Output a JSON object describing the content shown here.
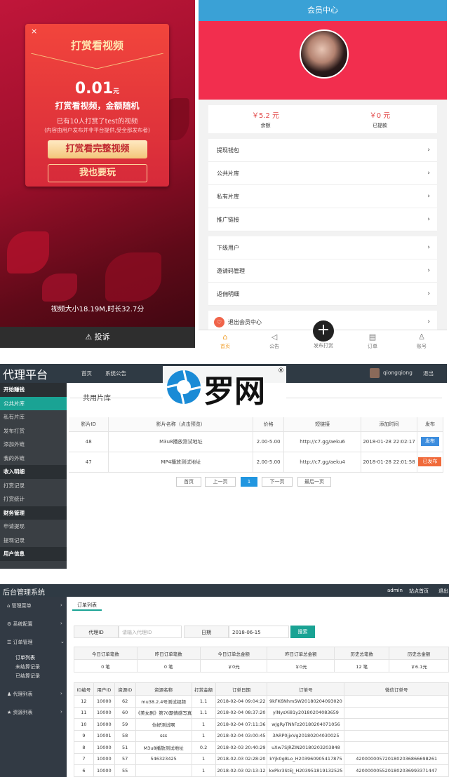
{
  "mobile_left": {
    "close": "×",
    "title": "打赏看视频",
    "amount": "0.01",
    "amount_unit": "元",
    "subtitle": "打赏看视频，金额随机",
    "info": "已有10人打赏了test的视频",
    "note": "(内容由用户发布并非平台提供,受全部发布者)",
    "primary_button": "打赏看完整视频",
    "secondary_button": "我也要玩",
    "video_info": "视频大小18.19M,时长32.7分",
    "complain": "⚠ 投诉"
  },
  "mobile_right": {
    "header": "会员中心",
    "balance_value": "￥5.2 元",
    "balance_label": "余额",
    "withdrawn_value": "￥0 元",
    "withdrawn_label": "已提款",
    "menu_group1": [
      "提现钱包",
      "公共片库",
      "私有片库",
      "推广链接"
    ],
    "menu_group2": [
      "下级用户",
      "邀请码管理",
      "返佣明细"
    ],
    "logout": "退出会员中心",
    "tabs": [
      "首页",
      "公告",
      "发布打赏",
      "订单",
      "账号"
    ]
  },
  "agent": {
    "brand": "代理平台",
    "nav": [
      "首页",
      "系统公告"
    ],
    "user": "qiongqiong",
    "logout": "退出",
    "logo_text": "罗网",
    "sidebar": [
      {
        "label": "开始赚钱",
        "type": "grp"
      },
      {
        "label": "公共片库",
        "type": "act"
      },
      {
        "label": "私有片库",
        "type": "it"
      },
      {
        "label": "发布打赏",
        "type": "it"
      },
      {
        "label": "添加外链",
        "type": "it"
      },
      {
        "label": "我的外链",
        "type": "it"
      },
      {
        "label": "收入明细",
        "type": "grp"
      },
      {
        "label": "打赏记录",
        "type": "it"
      },
      {
        "label": "打赏统计",
        "type": "it"
      },
      {
        "label": "财务管理",
        "type": "grp"
      },
      {
        "label": "申请提现",
        "type": "it"
      },
      {
        "label": "提现记录",
        "type": "it"
      },
      {
        "label": "用户信息",
        "type": "grp"
      }
    ],
    "page_title": "共用片库",
    "columns": [
      "影片ID",
      "影片名称（点击预览）",
      "价格",
      "短链接",
      "添加时间",
      "发布"
    ],
    "rows": [
      {
        "id": "48",
        "name": "M3u8播放测试地址",
        "price": "2.00-5.00",
        "link": "http://c7.gg/aeku6",
        "time": "2018-01-28 22:02:17",
        "action": "发布"
      },
      {
        "id": "47",
        "name": "MP4播放测试地址",
        "price": "2.00-5.00",
        "link": "http://c7.gg/aeku4",
        "time": "2018-01-28 22:01:58",
        "action": "已发布"
      }
    ],
    "pager": [
      "首页",
      "上一页",
      "1",
      "下一页",
      "最后一页"
    ]
  },
  "admin": {
    "brand": "后台管理系统",
    "top_links": [
      "admin",
      "站点首页",
      "退出"
    ],
    "sidebar": [
      "管理菜单",
      "系统配置",
      "订单管理",
      "订单列表",
      "未结算记录",
      "已结算记录",
      "代理列表",
      "资源列表"
    ],
    "tab": "订单列表",
    "agent_id_label": "代理ID",
    "agent_id_placeholder": "请输入代理ID",
    "date_label": "日期",
    "date_value": "2018-06-15",
    "search_button": "搜索",
    "stats_headers": [
      "今日订单笔数",
      "昨日订单笔数",
      "今日订单总金额",
      "昨日订单总金额",
      "历史总笔数",
      "历史总金额"
    ],
    "stats_values": [
      "0 笔",
      "0 笔",
      "￥0元",
      "￥0元",
      "12 笔",
      "￥6.1元"
    ],
    "order_headers": [
      "ID编号",
      "用户ID",
      "资源ID",
      "资源名称",
      "打赏金额",
      "订单日期",
      "订单号",
      "微信订单号"
    ],
    "orders": [
      [
        "12",
        "10000",
        "62",
        "mu38.2.4号测试视频",
        "1.1",
        "2018-02-04 09:04:22",
        "9kFK6NhmSW20180204093020",
        ""
      ],
      [
        "11",
        "10000",
        "60",
        "《美女剧》第70期情感写真",
        "1.1",
        "2018-02-04 08:37:20",
        "ylNysXi81y20180204083659",
        ""
      ],
      [
        "10",
        "10000",
        "59",
        "你好测试啊",
        "1",
        "2018-02-04 07:11:36",
        "wJgRyTNhFz20180204071056",
        ""
      ],
      [
        "9",
        "10001",
        "58",
        "sss",
        "1",
        "2018-02-04 03:00:45",
        "3ARP0jjxVg20180204030025",
        ""
      ],
      [
        "8",
        "10000",
        "51",
        "M3u8播放测试地址",
        "0.2",
        "2018-02-03 20:40:29",
        "uXw7SJRZIN20180203203848",
        ""
      ],
      [
        "7",
        "10000",
        "57",
        "546323425",
        "1",
        "2018-02-03 02:28:20",
        "kYjk0g8Lo_H203960905417875",
        "4200000057201802036866698261"
      ],
      [
        "6",
        "10000",
        "55",
        "",
        "1",
        "2018-02-03 02:13:12",
        "kxPkr3StEJ_H203951819132525",
        "4200000055201802036993371447"
      ]
    ]
  }
}
